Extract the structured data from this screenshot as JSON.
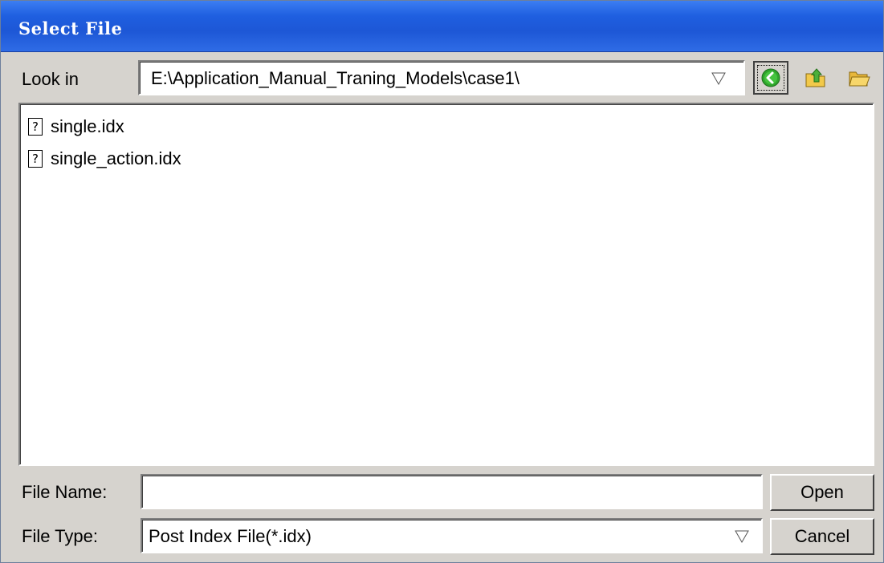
{
  "window": {
    "title": "Select File"
  },
  "look_in": {
    "label": "Look in",
    "value": "E:\\Application_Manual_Traning_Models\\case1\\"
  },
  "toolbar": {
    "back_icon": "back-arrow-icon",
    "up_icon": "up-folder-icon",
    "new_folder_icon": "new-folder-icon"
  },
  "files": [
    {
      "name": "single.idx",
      "icon": "unknown-file-icon"
    },
    {
      "name": "single_action.idx",
      "icon": "unknown-file-icon"
    }
  ],
  "file_name": {
    "label": "File Name:",
    "value": ""
  },
  "file_type": {
    "label": "File Type:",
    "value": "Post Index File(*.idx)"
  },
  "buttons": {
    "open": "Open",
    "cancel": "Cancel"
  },
  "colors": {
    "titlebar": "#1f5fe0",
    "dialog_bg": "#d6d3ce",
    "back_green": "#2fa52b",
    "folder_yellow": "#f2c94a"
  }
}
